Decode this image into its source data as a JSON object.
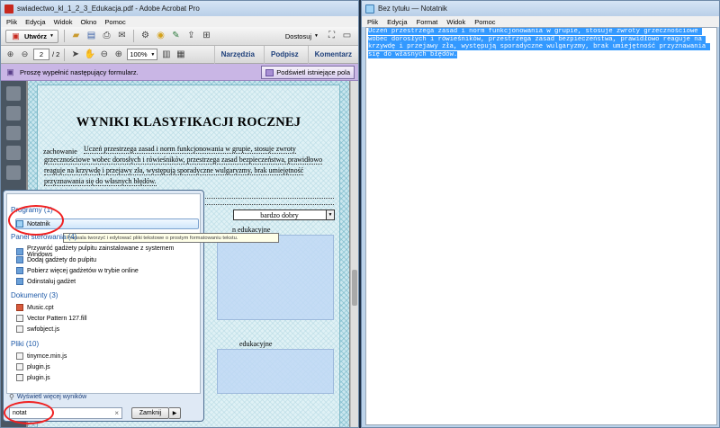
{
  "acrobat": {
    "title": "swiadectwo_kl_1_2_3_Edukacja.pdf - Adobe Acrobat Pro",
    "menu": [
      "Plik",
      "Edycja",
      "Widok",
      "Okno",
      "Pomoc"
    ],
    "toolbar": {
      "create_label": "Utwórz",
      "fit_label": "Dostosuj"
    },
    "nav": {
      "page_current": "2",
      "page_total": "/ 2",
      "zoom": "100%",
      "tools_label": "Narzędzia",
      "sign_label": "Podpisz",
      "comment_label": "Komentarz"
    },
    "formbar": {
      "message": "Proszę wypełnić następujący formularz.",
      "highlight_label": "Podświetl istniejące pola"
    },
    "document": {
      "heading": "WYNIKI KLASYFIKACJI ROCZNEJ",
      "behaviour_label": "zachowanie",
      "behaviour_text": "Uczeń przestrzega zasad i norm funkcjonowania w grupie, stosuje zwroty grzecznościowe wobec dorosłych i rówieśników, przestrzega zasad bezpieczeństwa, prawidłowo reaguje na krzywdę i przejawy zła, występują sporadyczne wulgaryzmy, brak umiejętność przyznawania się do własnych błędów.",
      "grade_value": "bardzo dobry",
      "fragment_1": "n edukacyjne",
      "fragment_2": "edukacyjne"
    }
  },
  "startmenu": {
    "programs_header": "Programy (1)",
    "programs": [
      {
        "label": "Notatnik"
      }
    ],
    "tooltip": "Pozwala tworzyć i edytować pliki tekstowe o prostym formatowaniu tekstu.",
    "control_panel_header": "Panel sterowania (4)",
    "control_panel": [
      {
        "label": "Przywróć gadżety pulpitu zainstalowane z systemem Windows"
      },
      {
        "label": "Dodaj gadżety do pulpitu"
      },
      {
        "label": "Pobierz więcej gadżetów w trybie online"
      },
      {
        "label": "Odinstaluj gadżet"
      }
    ],
    "documents_header": "Dokumenty (3)",
    "documents": [
      {
        "label": "Music.cpt"
      },
      {
        "label": "Vector Pattern 127.fill"
      },
      {
        "label": "swfobject.js"
      }
    ],
    "files_header": "Pliki (10)",
    "files": [
      {
        "label": "tinymce.min.js"
      },
      {
        "label": "plugin.js"
      },
      {
        "label": "plugin.js"
      }
    ],
    "more_results": "Wyświetl więcej wyników",
    "search_value": "notat",
    "close_label": "Zamknij"
  },
  "notepad": {
    "title": "Bez tytułu — Notatnik",
    "menu": [
      "Plik",
      "Edycja",
      "Format",
      "Widok",
      "Pomoc"
    ],
    "text": "Uczeń przestrzega zasad i norm funkcjonowania w grupie, stosuje zwroty grzecznościowe wobec dorosłych i rówieśników, przestrzega zasad bezpieczeństwa, prawidłowo reaguje na krzywdę i przejawy zła, występują sporadyczne wulgaryzmy, brak umiejętność przyznawania się do własnych błędów."
  },
  "colors": {
    "accent_blue": "#1e5aa8",
    "selection": "#3399ff",
    "form_bar": "#c9b6e5",
    "highlight_ring": "#f02020"
  }
}
